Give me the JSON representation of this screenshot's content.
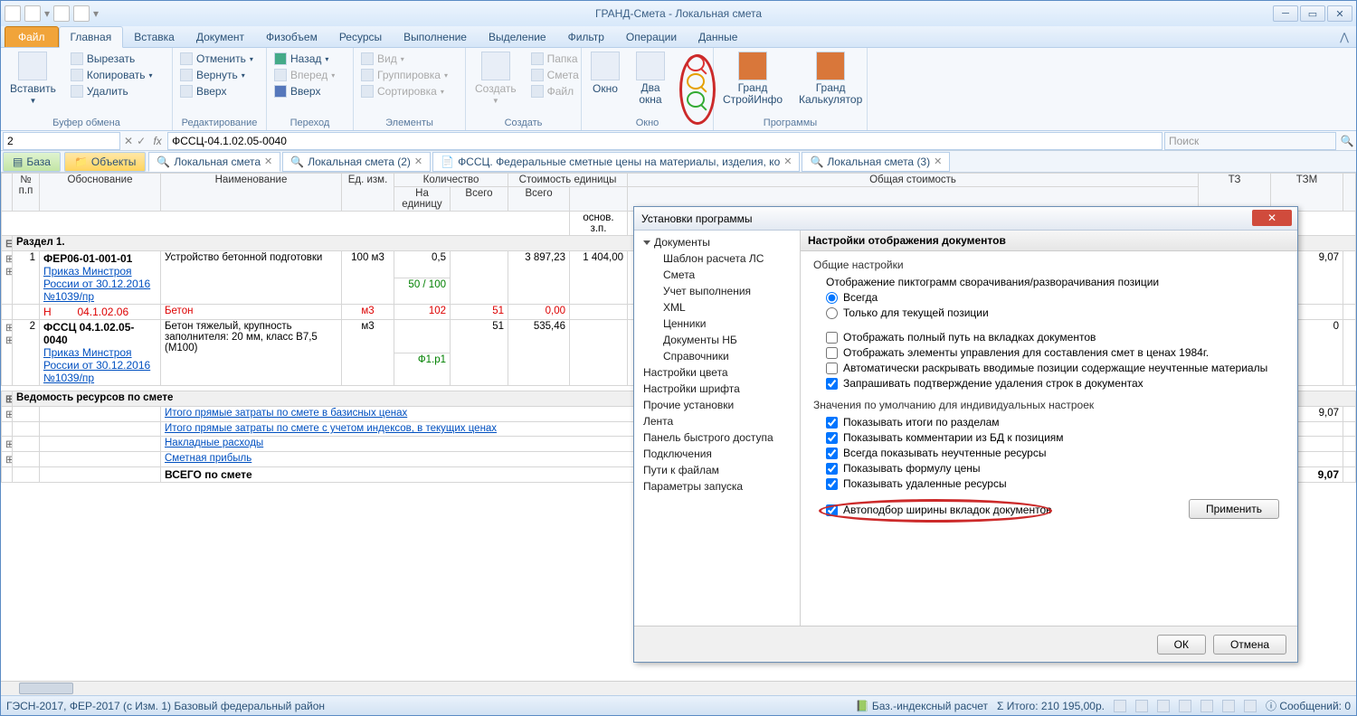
{
  "title": "ГРАНД-Смета - Локальная смета",
  "ribbon": {
    "file": "Файл",
    "tabs": [
      "Главная",
      "Вставка",
      "Документ",
      "Физобъем",
      "Ресурсы",
      "Выполнение",
      "Выделение",
      "Фильтр",
      "Операции",
      "Данные"
    ],
    "clipboard": {
      "paste": "Вставить",
      "cut": "Вырезать",
      "copy": "Копировать",
      "delete": "Удалить",
      "label": "Буфер обмена"
    },
    "edit": {
      "undo": "Отменить",
      "redo": "Вернуть",
      "up": "Вверх",
      "label": "Редактирование"
    },
    "nav": {
      "back": "Назад",
      "fwd": "Вперед",
      "upbtn": "Вверх",
      "label": "Переход"
    },
    "elem": {
      "view": "Вид",
      "group": "Группировка",
      "sort": "Сортировка",
      "label": "Элементы"
    },
    "create": {
      "create": "Создать",
      "folder": "Папка",
      "estimate": "Смета",
      "file": "Файл",
      "label": "Создать"
    },
    "window": {
      "win": "Окно",
      "two": "Два\nокна",
      "label": "Окно"
    },
    "programs": {
      "p1": "Гранд\nСтройИнфо",
      "p2": "Гранд\nКалькулятор",
      "label": "Программы"
    }
  },
  "formula": {
    "cell": "2",
    "value": "ФССЦ-04.1.02.05-0040",
    "search_ph": "Поиск"
  },
  "tabstrip": {
    "base": "База",
    "objects": "Объекты",
    "docs": [
      {
        "label": "Локальная смета",
        "close": true,
        "icon": "🔍"
      },
      {
        "label": "Локальная смета (2)",
        "close": true,
        "icon": "🔍"
      },
      {
        "label": "ФССЦ. Федеральные сметные цены на материалы, изделия, ко",
        "close": true,
        "icon": "📄"
      },
      {
        "label": "Локальная смета (3)",
        "close": true,
        "icon": "🔍"
      }
    ]
  },
  "grid": {
    "headers": {
      "no": "№\nп.п",
      "basis": "Обоснование",
      "name": "Наименование",
      "unit": "Ед. изм.",
      "qty": "Количество",
      "unitcost": "Стоимость единицы",
      "totalcost": "Общая стоимость",
      "tz": "ТЗ",
      "tzm": "ТЗМ",
      "perunit": "На\nединицу",
      "all": "Всего",
      "all2": "Всего",
      "basezp": "основ. з.п."
    },
    "section": "Раздел 1.",
    "rows": [
      {
        "no": "1",
        "code": "ФЕР06-01-001-01",
        "order": "Приказ Минстроя России от 30.12.2016 №1039/пр",
        "name": "Устройство бетонной подготовки",
        "unit": "100 м3",
        "per": "0,5",
        "ratio": "50 / 100",
        "all": "",
        "price": "3 897,23",
        "total": "1 404,00",
        "tzm": "9,07"
      },
      {
        "no": "",
        "code_h": "Н",
        "code_v": "04.1.02.06",
        "name": "Бетон",
        "unit": "м3",
        "per": "102",
        "all": "51",
        "price": "0,00"
      },
      {
        "no": "2",
        "code": "ФССЦ 04.1.02.05-0040",
        "order": "Приказ Минстроя России от 30.12.2016 №1039/пр",
        "name": "Бетон тяжелый, крупность заполнителя: 20 мм, класс В7,5 (М100)",
        "unit": "м3",
        "per": "",
        "all": "51",
        "ratio2": "Ф1.p1",
        "price": "535,46",
        "tzm": "0"
      }
    ],
    "summary_hdr": "Ведомость ресурсов по смете",
    "summary": [
      {
        "t": "Итого прямые затраты по смете в базисных ценах",
        "v": "9,07"
      },
      {
        "t": "Итого прямые затраты по смете с учетом индексов, в текущих ценах",
        "v": ""
      },
      {
        "t": "Накладные расходы",
        "v": ""
      },
      {
        "t": "Сметная прибыль",
        "v": ""
      },
      {
        "t": "ВСЕГО по смете",
        "v": "9,07",
        "bold": true
      }
    ]
  },
  "dialog": {
    "title": "Установки программы",
    "tree": [
      {
        "l": "Документы",
        "lvl": 0,
        "exp": true
      },
      {
        "l": "Шаблон расчета ЛС",
        "lvl": 1
      },
      {
        "l": "Смета",
        "lvl": 1
      },
      {
        "l": "Учет выполнения",
        "lvl": 1
      },
      {
        "l": "XML",
        "lvl": 1
      },
      {
        "l": "Ценники",
        "lvl": 1
      },
      {
        "l": "Документы НБ",
        "lvl": 1
      },
      {
        "l": "Справочники",
        "lvl": 1
      },
      {
        "l": "Настройки цвета",
        "lvl": 0
      },
      {
        "l": "Настройки шрифта",
        "lvl": 0
      },
      {
        "l": "Прочие установки",
        "lvl": 0
      },
      {
        "l": "Лента",
        "lvl": 0
      },
      {
        "l": "Панель быстрого доступа",
        "lvl": 0
      },
      {
        "l": "Подключения",
        "lvl": 0
      },
      {
        "l": "Пути к файлам",
        "lvl": 0
      },
      {
        "l": "Параметры запуска",
        "lvl": 0
      }
    ],
    "panel_title": "Настройки отображения документов",
    "general": "Общие настройки",
    "pictogram": "Отображение пиктограмм сворачивания/разворачивания позиции",
    "radio1": "Всегда",
    "radio2": "Только для текущей позиции",
    "chk1": "Отображать полный путь на вкладках документов",
    "chk2": "Отображать элементы управления для составления смет в ценах 1984г.",
    "chk3": "Автоматически раскрывать вводимые позиции содержащие неучтенные материалы",
    "chk4": "Запрашивать подтверждение удаления строк в документах",
    "defaults": "Значения по умолчанию для индивидуальных настроек",
    "chk5": "Показывать итоги по разделам",
    "chk6": "Показывать комментарии из БД к позициям",
    "chk7": "Всегда показывать неучтенные ресурсы",
    "chk8": "Показывать формулу цены",
    "chk9": "Показывать удаленные ресурсы",
    "chk10": "Автоподбор ширины вкладок документов",
    "apply": "Применить",
    "ok": "ОК",
    "cancel": "Отмена"
  },
  "status": {
    "left": "ГЭСН-2017, ФЕР-2017 (с Изм. 1)   Базовый федеральный район",
    "calc": "Баз.-индексный расчет",
    "sum": "Итого: 210 195,00р.",
    "msg": "Сообщений: 0"
  }
}
